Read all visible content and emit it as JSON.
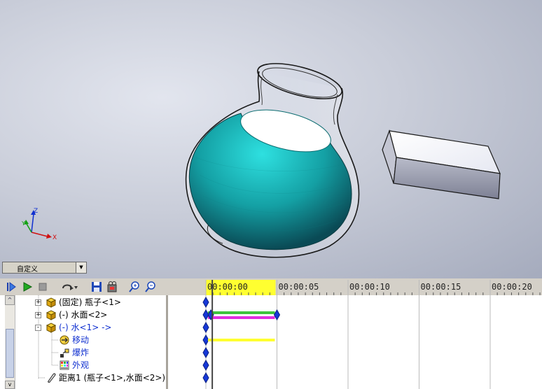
{
  "view_selector": {
    "value": "自定义"
  },
  "timeline": {
    "ticks": [
      "00:00:00",
      "00:00:05",
      "00:00:10",
      "00:00:15",
      "00:00:20"
    ],
    "tick_seconds": [
      0,
      5,
      10,
      15,
      20
    ],
    "current_time_seconds": 0.45
  },
  "tree": {
    "items": [
      {
        "label": "(固定) 瓶子<1>",
        "icon": "component-icon",
        "color": "#000000"
      },
      {
        "label": "(-) 水面<2>",
        "icon": "component-icon",
        "color": "#000000"
      },
      {
        "label": "(-) 水<1> ->",
        "icon": "component-icon",
        "color": "#1030d0"
      },
      {
        "label": "移动",
        "icon": "move-icon",
        "color": "#1030d0"
      },
      {
        "label": "爆炸",
        "icon": "explode-icon",
        "color": "#1030d0"
      },
      {
        "label": "外观",
        "icon": "appearance-icon",
        "color": "#1030d0"
      },
      {
        "label": "距离1 (瓶子<1>,水面<2>)",
        "icon": "mate-clip-icon",
        "color": "#000000"
      }
    ]
  },
  "colors": {
    "water": "#1fb5b5",
    "green_bar": "#3ec43e",
    "magenta_bar": "#e22ee2",
    "yellow_bar": "#ffff30",
    "key_point": "#1638d8"
  },
  "axis_triad": {
    "x": "X",
    "y": "Y",
    "z": "Z"
  }
}
